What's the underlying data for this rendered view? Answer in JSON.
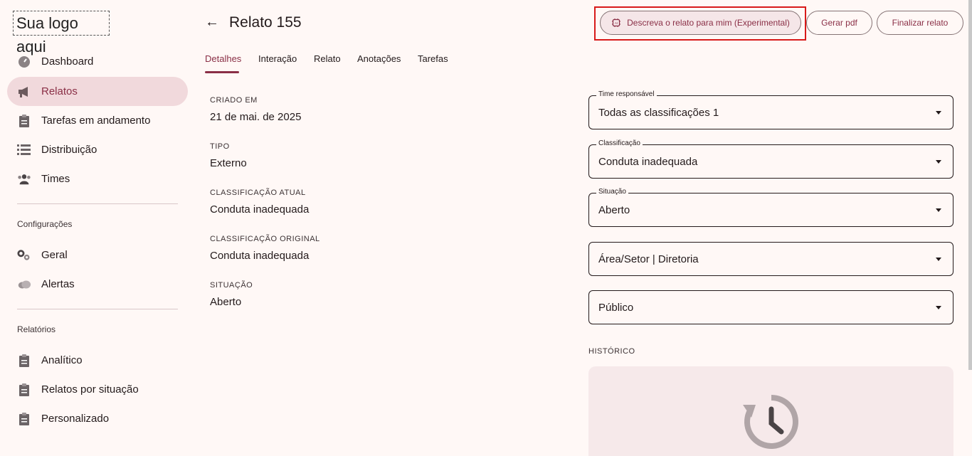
{
  "logo": {
    "text": "Sua logo aqui"
  },
  "sidebar": {
    "items": [
      {
        "label": "Dashboard",
        "icon": "dashboard-icon"
      },
      {
        "label": "Relatos",
        "icon": "megaphone-icon",
        "active": true
      },
      {
        "label": "Tarefas em andamento",
        "icon": "clipboard-icon"
      },
      {
        "label": "Distribuição",
        "icon": "list-icon"
      },
      {
        "label": "Times",
        "icon": "group-icon"
      }
    ],
    "config_label": "Configurações",
    "config_items": [
      {
        "label": "Geral",
        "icon": "gears-icon"
      },
      {
        "label": "Alertas",
        "icon": "cloud-icon"
      }
    ],
    "reports_label": "Relatórios",
    "report_items": [
      {
        "label": "Analítico",
        "icon": "clipboard-icon"
      },
      {
        "label": "Relatos por situação",
        "icon": "clipboard-icon"
      },
      {
        "label": "Personalizado",
        "icon": "clipboard-icon"
      }
    ]
  },
  "header": {
    "back": "←",
    "title": "Relato 155",
    "ai_button": "Descreva o relato para mim (Experimental)",
    "pdf_button": "Gerar pdf",
    "finish_button": "Finalizar relato"
  },
  "tabs": [
    "Detalhes",
    "Interação",
    "Relato",
    "Anotações",
    "Tarefas"
  ],
  "details": [
    {
      "label": "CRIADO EM",
      "value": "21 de mai. de 2025"
    },
    {
      "label": "TIPO",
      "value": "Externo"
    },
    {
      "label": "CLASSIFICAÇÃO ATUAL",
      "value": "Conduta inadequada"
    },
    {
      "label": "CLASSIFICAÇÃO ORIGINAL",
      "value": "Conduta inadequada"
    },
    {
      "label": "SITUAÇÃO",
      "value": "Aberto"
    }
  ],
  "fields": [
    {
      "legend": "Time responsável",
      "value": "Todas as classificações 1"
    },
    {
      "legend": "Classificação",
      "value": "Conduta inadequada"
    },
    {
      "legend": "Situação",
      "value": "Aberto"
    },
    {
      "legend": "",
      "value": "Área/Setor | Diretoria"
    },
    {
      "legend": "",
      "value": "Público"
    }
  ],
  "history": {
    "label": "HISTÓRICO",
    "icon": "history-icon"
  },
  "colors": {
    "accent": "#8a2f46",
    "active_bg": "#f1d9dc",
    "background": "#fff8f6",
    "highlight": "#d81a1a"
  }
}
